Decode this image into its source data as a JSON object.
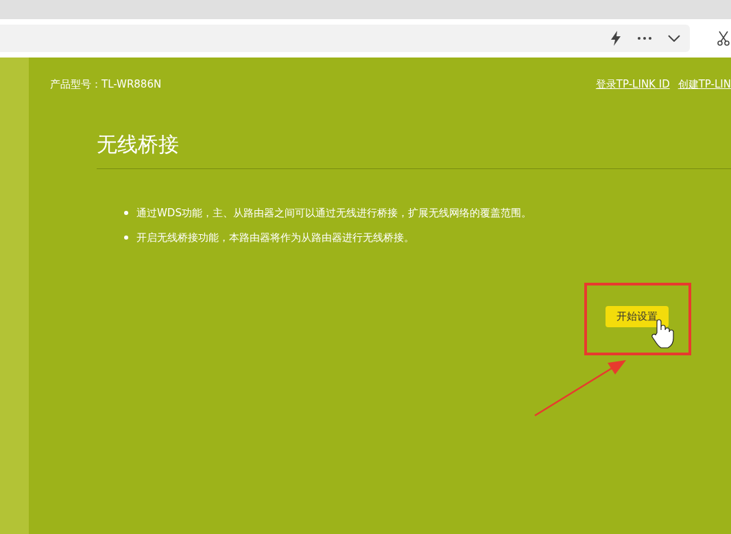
{
  "header": {
    "product_label": "产品型号：TL-WR886N",
    "links": [
      "登录TP-LINK ID",
      "创建TP-LIN"
    ]
  },
  "title": "无线桥接",
  "bullets": [
    "通过WDS功能，主、从路由器之间可以通过无线进行桥接，扩展无线网络的覆盖范围。",
    "开启无线桥接功能，本路由器将作为从路由器进行无线桥接。"
  ],
  "start_button": "开始设置"
}
